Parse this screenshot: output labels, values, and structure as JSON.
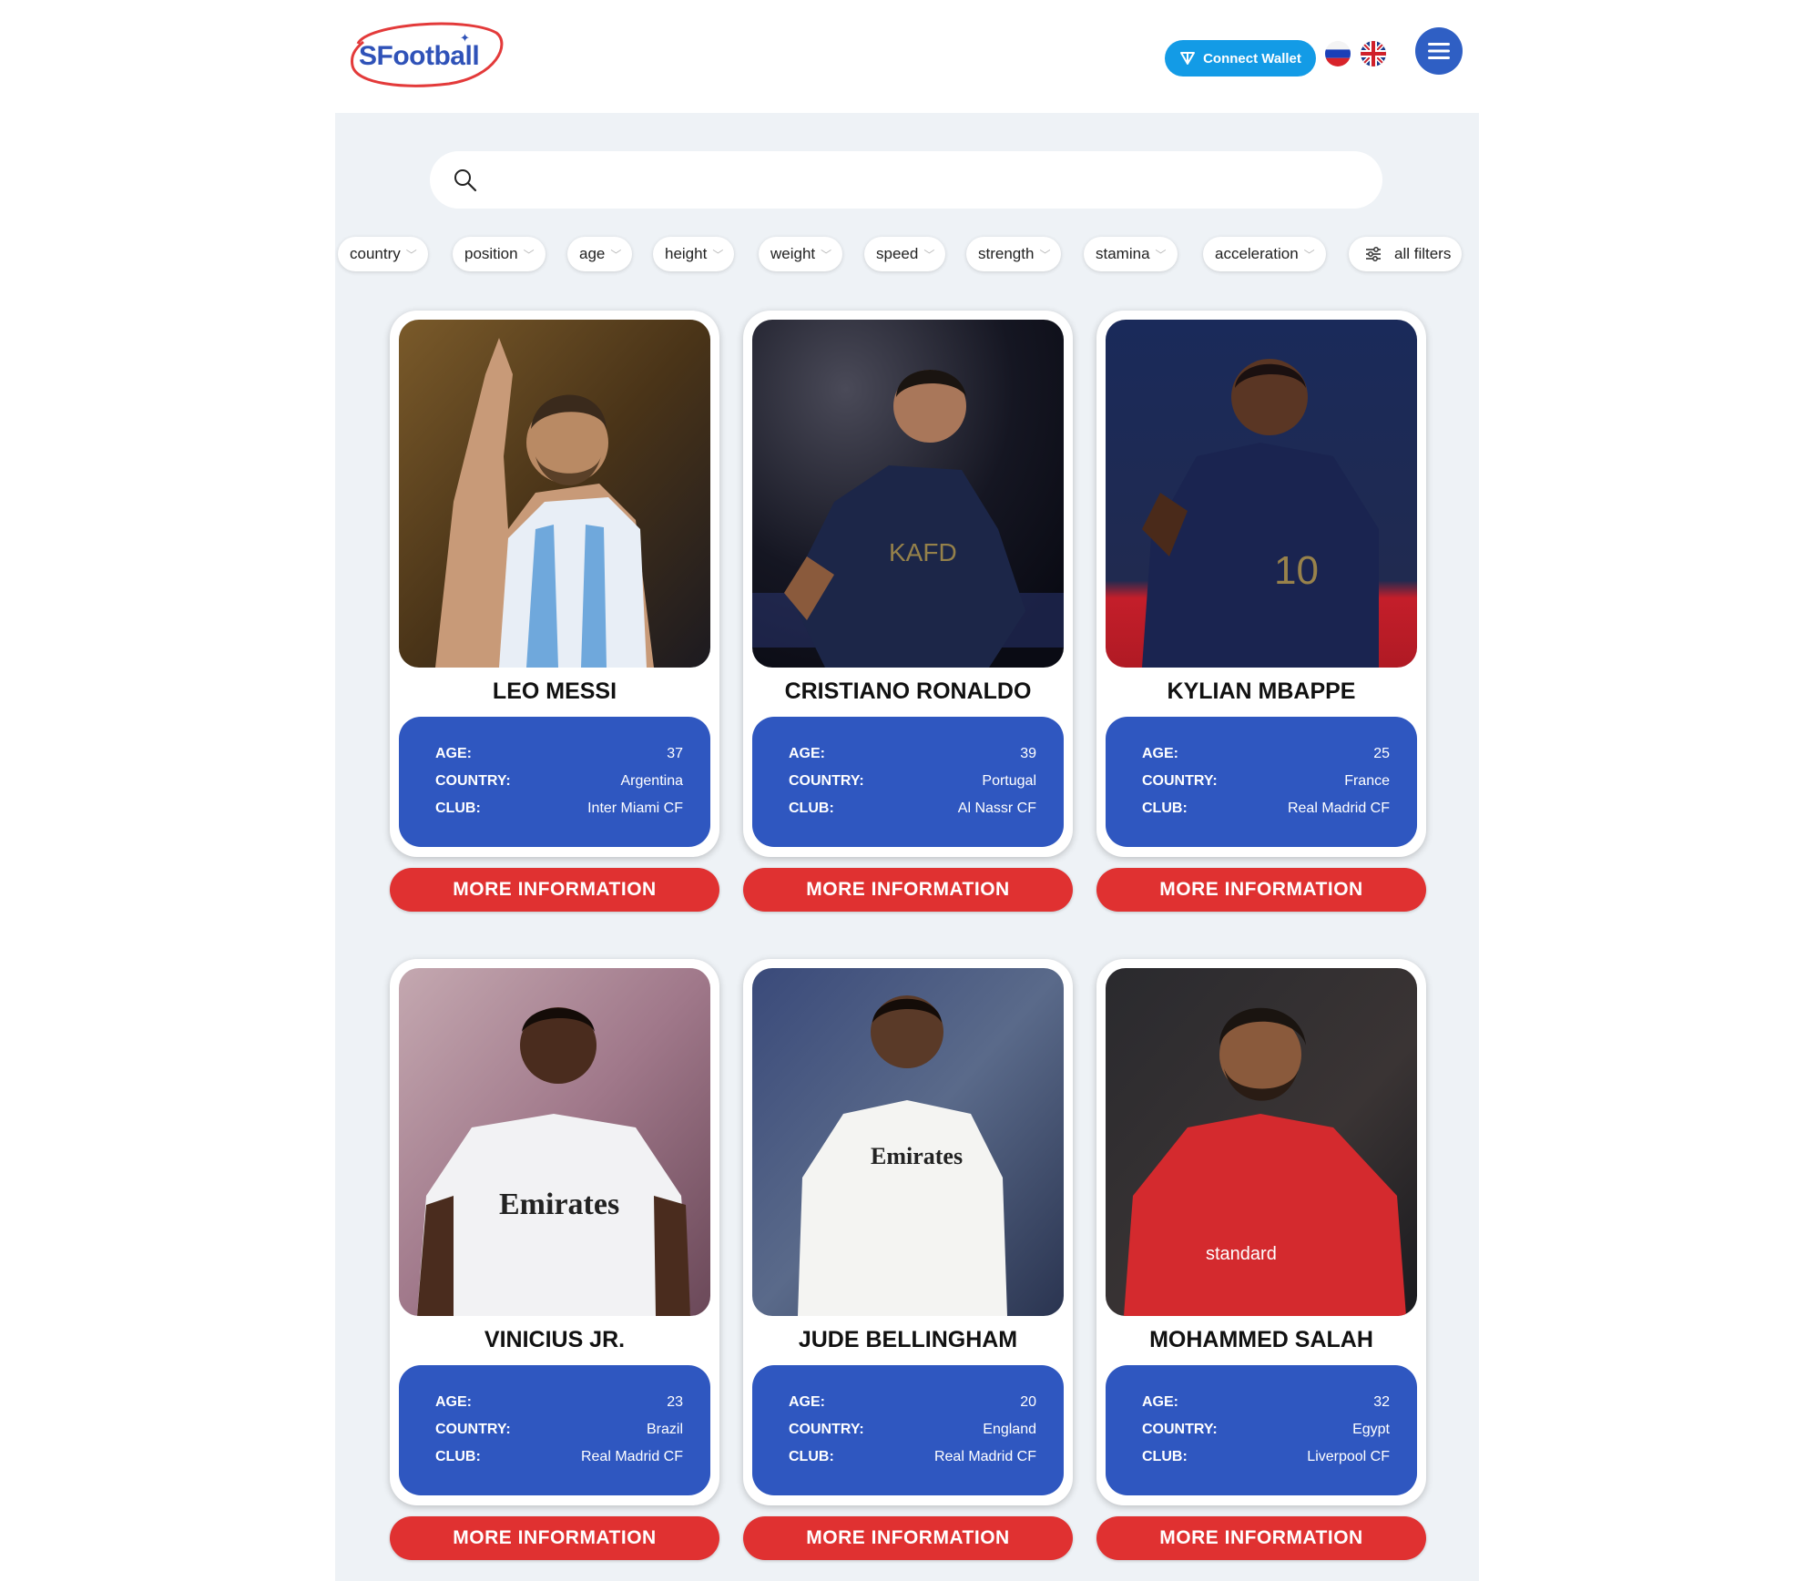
{
  "header": {
    "logo_text": "SFootball",
    "wallet_button_label": "Connect Wallet",
    "languages": [
      "ru",
      "en"
    ]
  },
  "search": {
    "placeholder": "",
    "value": ""
  },
  "filters": [
    {
      "label": "country"
    },
    {
      "label": "position"
    },
    {
      "label": "age"
    },
    {
      "label": "height"
    },
    {
      "label": "weight"
    },
    {
      "label": "speed"
    },
    {
      "label": "strength"
    },
    {
      "label": "stamina"
    },
    {
      "label": "acceleration"
    }
  ],
  "all_filters_label": "all filters",
  "stat_labels": {
    "age": "AGE:",
    "country": "COUNTRY:",
    "club": "CLUB:"
  },
  "more_button_label": "MORE INFORMATION",
  "players": [
    {
      "name": "LEO MESSI",
      "age": "37",
      "country": "Argentina",
      "club": "Inter Miami CF"
    },
    {
      "name": "CRISTIANO RONALDO",
      "age": "39",
      "country": "Portugal",
      "club": "Al Nassr CF"
    },
    {
      "name": "KYLIAN MBAPPE",
      "age": "25",
      "country": "France",
      "club": "Real Madrid CF"
    },
    {
      "name": "VINICIUS JR.",
      "age": "23",
      "country": "Brazil",
      "club": "Real Madrid CF"
    },
    {
      "name": "JUDE BELLINGHAM",
      "age": "20",
      "country": "England",
      "club": "Real Madrid CF"
    },
    {
      "name": "MOHAMMED SALAH",
      "age": "32",
      "country": "Egypt",
      "club": "Liverpool CF"
    }
  ],
  "colors": {
    "accent_blue": "#2f57c0",
    "wallet_blue": "#139be6",
    "button_red": "#e03131",
    "panel_bg": "#eef2f6"
  }
}
